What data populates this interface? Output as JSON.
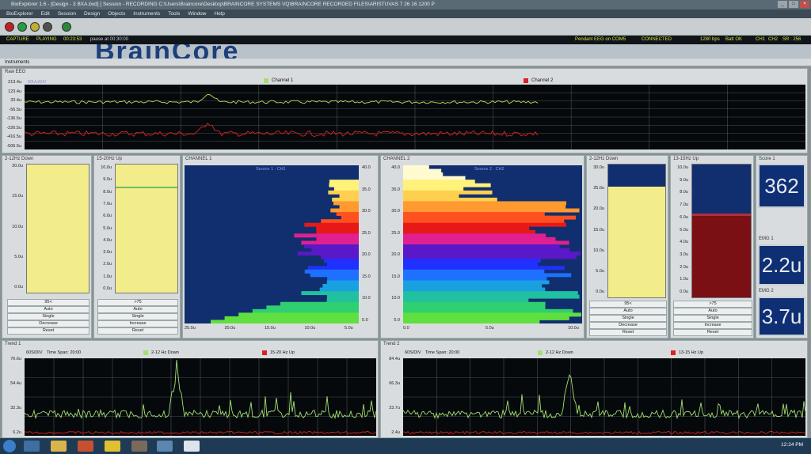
{
  "window": {
    "title": "BioExplorer 1.6 - [Design - 3 BXA.bxd] [ Session - RECORDING C:\\Users\\Braincore\\Desktop\\BRAINCORE SYSTEMS VQ\\BRAINCORE RECORDED FILES\\ARISTUVAS 7 26 16 1200 P",
    "min": "_",
    "max": "□",
    "close": "×"
  },
  "menu": [
    "BioExplorer",
    "Edit",
    "Session",
    "Design",
    "Objects",
    "Instruments",
    "Tools",
    "Window",
    "Help"
  ],
  "status": {
    "capture": "CAPTURE",
    "playing": "PLAYING",
    "elapsed": "00:23:53",
    "pause": "pause at 00:30:00",
    "device": "Pendant EEG on COM5",
    "connected": "CONNECTED",
    "bps": "1280 bps",
    "batt": "Batt OK",
    "ch1": "CH1",
    "ch2": "CH2",
    "sr": "SR : 256"
  },
  "banner": {
    "logo": "BrainCore"
  },
  "instruments_tab": "Instruments",
  "raw_eeg": {
    "title": "Raw EEG",
    "scale": "50Uv/DIV",
    "legend1": "Channel 1",
    "legend2": "Channel 2",
    "yticks": [
      "213.4u",
      "123.4u",
      "33.4u",
      "-56.5u",
      "-136.5u",
      "-226.5u",
      "-416.5u",
      "-506.5u"
    ],
    "colors": {
      "ch1": "#b8e05a",
      "ch2": "#e02020"
    }
  },
  "down_left": {
    "title": "2-12Hz Down",
    "yticks": [
      "20.0u",
      "15.0u",
      "10.0u",
      "5.0u",
      "0.0u"
    ],
    "threshold_label": "95<",
    "level": 1.0,
    "buttons": [
      "Auto",
      "Single",
      "Decrease",
      "Reset"
    ]
  },
  "up_left": {
    "title": "15-20Hz Up",
    "yticks": [
      "10.0u",
      "9.0u",
      "8.0u",
      "7.0u",
      "6.0u",
      "5.0u",
      "4.0u",
      "3.0u",
      "2.0u",
      "1.0u",
      "0.0u"
    ],
    "threshold_label": ">75",
    "level": 1.0,
    "threshold": 8.0,
    "buttons": [
      "Auto",
      "Single",
      "Increase",
      "Reset"
    ]
  },
  "channel1": {
    "title": "CHANNEL 1",
    "subtitle": "Source 1 : CH1",
    "xticks": [
      "25.0u",
      "20.0u",
      "15.0u",
      "10.0u",
      "5.0u"
    ],
    "yticks": [
      "40.0",
      "35.0",
      "30.0",
      "25.0",
      "20.0",
      "15.0",
      "10.0",
      "5.0"
    ]
  },
  "channel2": {
    "title": "CHANNEL 2",
    "subtitle": "Source 2 : CH2",
    "xticks": [
      "0.0",
      "5.0u",
      "10.0u"
    ],
    "yticks": [
      "40.0",
      "35.0",
      "30.0",
      "25.0",
      "20.0",
      "15.0",
      "10.0",
      "5.0"
    ]
  },
  "down_right": {
    "title": "2-12Hz Down",
    "yticks": [
      "30.0u",
      "25.0u",
      "20.0u",
      "15.0u",
      "10.0u",
      "5.0u",
      "0.0u"
    ],
    "threshold_label": "95<",
    "level": 0.83,
    "buttons": [
      "Auto",
      "Single",
      "Decrease",
      "Reset"
    ]
  },
  "up_right": {
    "title": "13-15Hz Up",
    "yticks": [
      "10.0u",
      "9.0u",
      "8.0u",
      "7.0u",
      "6.0u",
      "5.0u",
      "4.0u",
      "3.0u",
      "2.0u",
      "1.0u",
      "0.0u"
    ],
    "threshold_label": ">75",
    "level": 0.6,
    "buttons": [
      "Auto",
      "Single",
      "Increase",
      "Reset"
    ]
  },
  "score1": {
    "title": "Score 1",
    "value": "362"
  },
  "emg1": {
    "title": "EMG 1",
    "value": "2.2u"
  },
  "emg2": {
    "title": "EMG 2",
    "value": "3.7u"
  },
  "trend1": {
    "title": "Trend 1",
    "scale": "60S/DIV",
    "span": "Time Span: 20:00",
    "legend1": "2-12 Hz Down",
    "legend2": "15-20 Hz Up",
    "yticks": [
      "76.6u",
      "54.4u",
      "32.3u",
      "6.2u"
    ]
  },
  "trend2": {
    "title": "Trend 2",
    "scale": "60S/DIV",
    "span": "Time Span: 20:00",
    "legend1": "2-12 Hz Down",
    "legend2": "13-15 Hz Up",
    "yticks": [
      "84.4u",
      "66.3u",
      "23.7u",
      "2.4u"
    ]
  },
  "taskbar": {
    "time": "12:24 PM"
  },
  "colors": {
    "green": "#a4e070",
    "red": "#e02020",
    "yellow": "#f3ec8a",
    "navy": "#112f6e",
    "maroon": "#7a0f14"
  }
}
